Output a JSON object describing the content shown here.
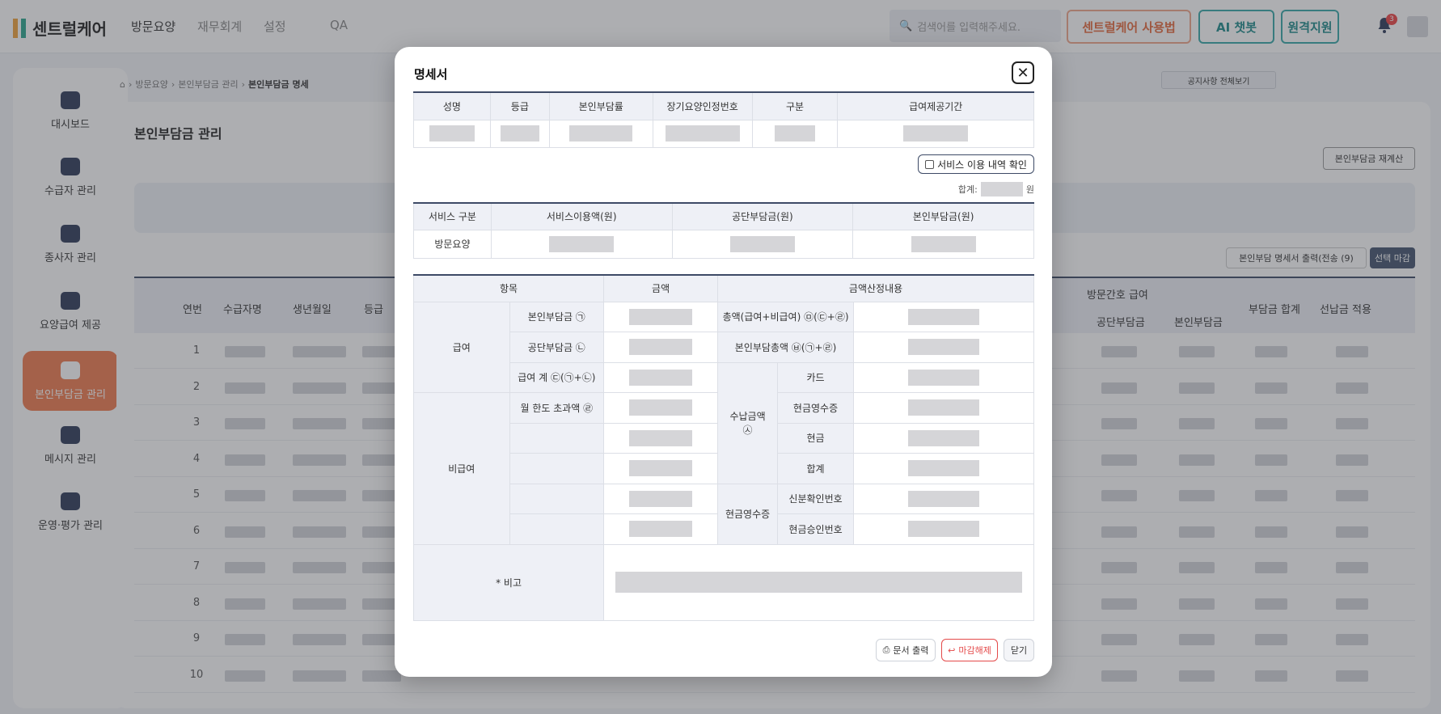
{
  "app": {
    "logo_text": "센트럴케어",
    "nav": [
      "방문요양",
      "재무회계",
      "설정",
      "QA"
    ],
    "search_placeholder": "검색어를 입력해주세요.",
    "guide_button": "센트럴케어 사용법",
    "ai_button": "AI 챗봇",
    "remote_button": "원격지원",
    "notification_count": "3"
  },
  "sidebar": {
    "items": [
      {
        "label": "대시보드"
      },
      {
        "label": "수급자 관리"
      },
      {
        "label": "종사자 관리"
      },
      {
        "label": "요양급여 제공"
      },
      {
        "label": "본인부담금 관리"
      },
      {
        "label": "메시지 관리"
      },
      {
        "label": "운영·평가 관리"
      }
    ]
  },
  "page": {
    "breadcrumb": [
      "방문요양",
      "본인부담금 관리",
      "본인부담금 명세"
    ],
    "notice_button": "공지사항 전체보기",
    "title": "본인부담금 관리",
    "recalc_button": "본인부담금 재계산",
    "print_button": "본인부담 명세서 출력(전송 (9)",
    "select_close_button": "선택 마감",
    "grid_headers": [
      "연번",
      "수급자명",
      "생년월일",
      "등급",
      "방문간호 급여",
      "공단부담금",
      "본인부담금",
      "부담금 합계",
      "선납금 적용"
    ],
    "row_numbers": [
      "1",
      "2",
      "3",
      "4",
      "5",
      "6",
      "7",
      "8",
      "9",
      "10"
    ]
  },
  "modal": {
    "title": "명세서",
    "info_headers": [
      "성명",
      "등급",
      "본인부담률",
      "장기요양인정번호",
      "구분",
      "급여제공기간"
    ],
    "service_history_button": "서비스 이용 내역 확인",
    "total_label": "합계:",
    "total_unit": "원",
    "service_headers": [
      "서비스 구분",
      "서비스이용액(원)",
      "공단부담금(원)",
      "본인부담금(원)"
    ],
    "service_row_label": "방문요양",
    "detail_headers": [
      "항목",
      "금액",
      "금액산정내용"
    ],
    "group_benefit": "급여",
    "group_nonbenefit": "비급여",
    "item_self_pay": "본인부담금 ㉠",
    "item_public_pay": "공단부담금 ㉡",
    "item_benefit_sum": "급여 계 ㉢(㉠+㉡)",
    "item_over_limit": "월 한도 초과액 ㉣",
    "calc_total": "총액(급여+비급여) ㉤(㉢+㉣)",
    "calc_self_total": "본인부담총액 ㉥(㉠+㉣)",
    "received_label": "수납금액",
    "received_symbol": "㉦",
    "card": "카드",
    "cash_receipt": "현금영수증",
    "cash": "현금",
    "sum": "합계",
    "receipt_group": "현금영수증",
    "id_number": "신분확인번호",
    "approval_number": "현금승인번호",
    "note_label": "* 비고",
    "buttons": {
      "print": "문서 출력",
      "unclose": "마감해제",
      "close": "닫기"
    }
  }
}
